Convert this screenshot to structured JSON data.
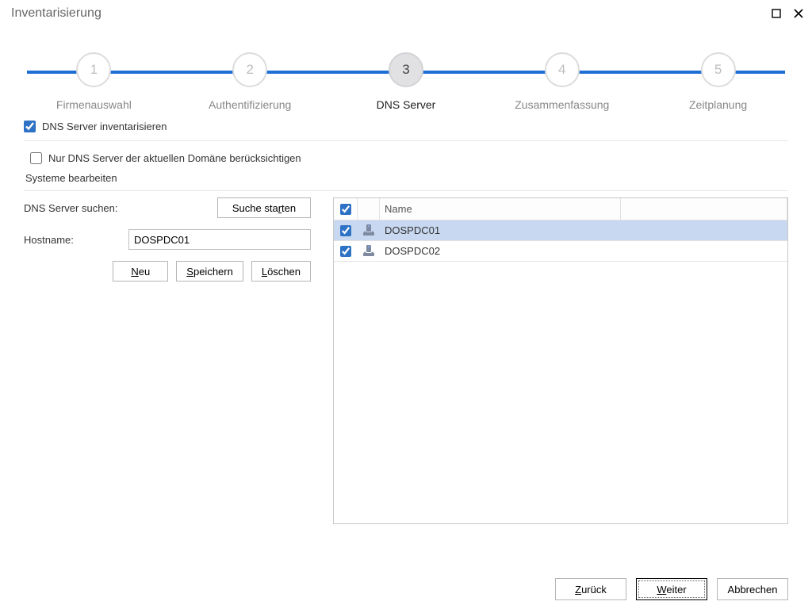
{
  "window": {
    "title": "Inventarisierung"
  },
  "stepper": {
    "steps": [
      {
        "num": "1",
        "label": "Firmenauswahl",
        "active": false
      },
      {
        "num": "2",
        "label": "Authentifizierung",
        "active": false
      },
      {
        "num": "3",
        "label": "DNS Server",
        "active": true
      },
      {
        "num": "4",
        "label": "Zusammenfassung",
        "active": false
      },
      {
        "num": "5",
        "label": "Zeitplanung",
        "active": false
      }
    ]
  },
  "options": {
    "inventory_dns": {
      "checked": true,
      "label": "DNS Server inventarisieren"
    },
    "only_current_domain": {
      "checked": false,
      "label": "Nur DNS Server der aktuellen Domäne berücksichtigen"
    }
  },
  "section_title": "Systeme bearbeiten",
  "left": {
    "search_label": "DNS Server suchen:",
    "search_button": "Suche starten",
    "search_button_pre": "Suche sta",
    "search_button_u": "r",
    "search_button_post": "ten",
    "hostname_label": "Hostname:",
    "hostname_value": "DOSPDC01",
    "new_pre": "",
    "new_u": "N",
    "new_post": "eu",
    "save_pre": "",
    "save_u": "S",
    "save_post": "peichern",
    "del_pre": "",
    "del_u": "L",
    "del_post": "öschen"
  },
  "grid": {
    "header_name": "Name",
    "header_all_checked": true,
    "rows": [
      {
        "checked": true,
        "name": "DOSPDC01",
        "selected": true
      },
      {
        "checked": true,
        "name": "DOSPDC02",
        "selected": false
      }
    ]
  },
  "footer": {
    "back_pre": "",
    "back_u": "Z",
    "back_post": "urück",
    "next_pre": "",
    "next_u": "W",
    "next_post": "eiter",
    "cancel": "Abbrechen"
  }
}
